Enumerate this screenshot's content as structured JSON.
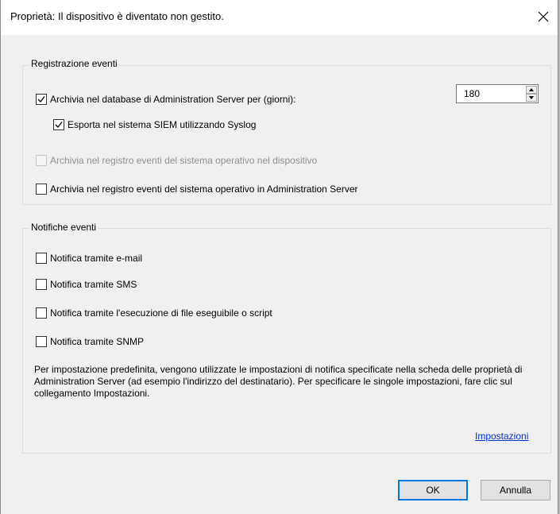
{
  "dialog": {
    "title": "Proprietà: Il dispositivo è diventato non gestito."
  },
  "event_registration": {
    "label": "Registrazione eventi",
    "archive_db": {
      "label": "Archivia nel database di Administration Server per (giorni):",
      "checked": true
    },
    "days_value": "180",
    "export_siem": {
      "label": "Esporta nel sistema SIEM utilizzando Syslog",
      "checked": true
    },
    "archive_device_os_log": {
      "label": "Archivia nel registro eventi del sistema operativo nel dispositivo",
      "checked": false,
      "disabled": true
    },
    "archive_server_os_log": {
      "label": "Archivia nel registro eventi del sistema operativo in Administration Server",
      "checked": false
    }
  },
  "event_notifications": {
    "label": "Notifiche eventi",
    "email": {
      "label": "Notifica tramite e-mail",
      "checked": false
    },
    "sms": {
      "label": "Notifica tramite SMS",
      "checked": false
    },
    "script": {
      "label": "Notifica tramite l'esecuzione di file eseguibile o script",
      "checked": false
    },
    "snmp": {
      "label": "Notifica tramite SNMP",
      "checked": false
    },
    "info_text": "Per impostazione predefinita, vengono utilizzate le impostazioni di notifica specificate nella scheda delle proprietà di Administration Server (ad esempio l'indirizzo del destinatario). Per specificare le singole impostazioni, fare clic sul collegamento Impostazioni.",
    "settings_link": "Impostazioni"
  },
  "buttons": {
    "ok": "OK",
    "cancel": "Annulla"
  },
  "colors": {
    "accent": "#0078d7",
    "link": "#0033cc"
  }
}
